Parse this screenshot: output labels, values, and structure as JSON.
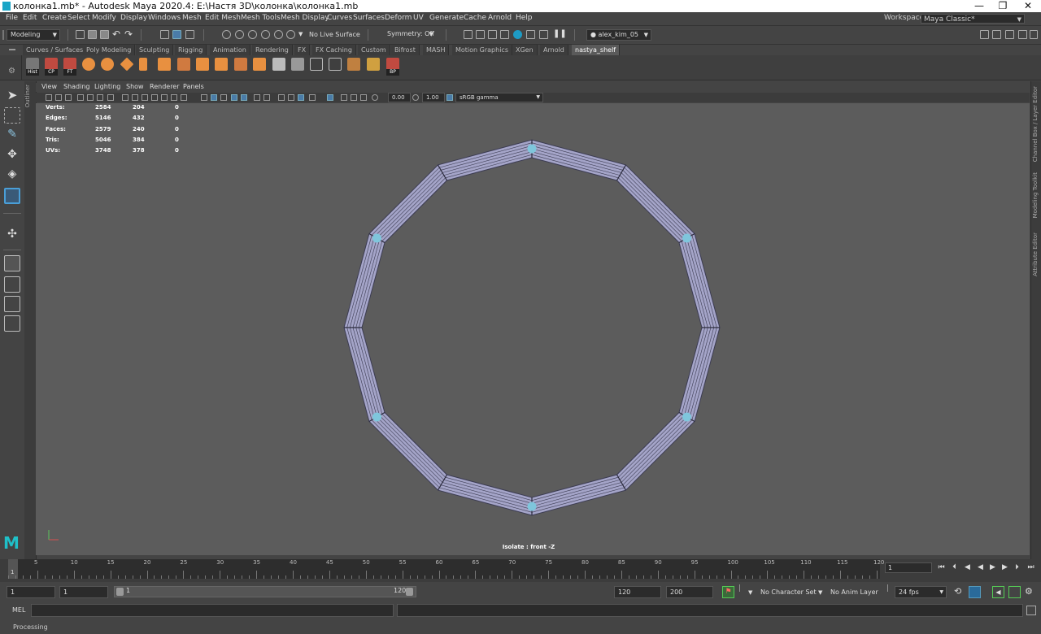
{
  "window": {
    "title": "колонка1.mb* - Autodesk Maya 2020.4: E:\\Настя 3D\\колонка\\колонка1.mb",
    "controls": [
      "—",
      "❐",
      "✕"
    ]
  },
  "menubar": {
    "items": [
      "File",
      "Edit",
      "Create",
      "Select",
      "Modify",
      "Display",
      "Windows",
      "Mesh",
      "Edit Mesh",
      "Mesh Tools",
      "Mesh Display",
      "Curves",
      "Surfaces",
      "Deform",
      "UV",
      "Generate",
      "Cache",
      "Arnold",
      "Help"
    ],
    "workspace_label": "Workspace :",
    "workspace_value": "Maya Classic*"
  },
  "statusline": {
    "mode": "Modeling",
    "live_surface": "No Live Surface",
    "symmetry": "Symmetry: Off",
    "user": "alex_kim_05"
  },
  "shelf": {
    "tabs": [
      "Curves / Surfaces",
      "Poly Modeling",
      "Sculpting",
      "Rigging",
      "Animation",
      "Rendering",
      "FX",
      "FX Caching",
      "Custom",
      "Bifrost",
      "MASH",
      "Motion Graphics",
      "XGen",
      "Arnold",
      "nastya_shelf"
    ],
    "active_tab": "nastya_shelf",
    "button_labels": [
      "Hist",
      "CP",
      "FT",
      "BP"
    ]
  },
  "panel": {
    "menus": [
      "View",
      "Shading",
      "Lighting",
      "Show",
      "Renderer",
      "Panels"
    ],
    "exposure": "0.00",
    "gamma": "1.00",
    "color_space": "sRGB gamma"
  },
  "outliner_label": "Outliner",
  "right_tabs": [
    "Channel Box / Layer Editor",
    "Modeling Toolkit",
    "Attribute Editor"
  ],
  "hud": {
    "rows": [
      {
        "label": "Verts:",
        "a": "2584",
        "b": "204",
        "c": "0"
      },
      {
        "label": "Edges:",
        "a": "5146",
        "b": "432",
        "c": "0"
      },
      {
        "label": "Faces:",
        "a": "2579",
        "b": "240",
        "c": "0"
      },
      {
        "label": "Tris:",
        "a": "5046",
        "b": "384",
        "c": "0"
      },
      {
        "label": "UVs:",
        "a": "3748",
        "b": "378",
        "c": "0"
      }
    ]
  },
  "viewport": {
    "isolate_label": "Isolate : front -Z",
    "mesh_color": "#a4a4c8",
    "vertex_color": "#7fc6dc"
  },
  "timeline": {
    "ticks": [
      "5",
      "10",
      "15",
      "20",
      "25",
      "30",
      "35",
      "40",
      "45",
      "50",
      "55",
      "60",
      "65",
      "70",
      "75",
      "80",
      "85",
      "90",
      "95",
      "100",
      "105",
      "110",
      "115",
      "120"
    ],
    "start_label": "1",
    "end_label": "120",
    "current_frame": "1"
  },
  "range": {
    "start_field": "1",
    "playback_start": "1",
    "slider_start": "1",
    "slider_end": "120",
    "playback_end": "120",
    "end_field": "200",
    "character_set": "No Character Set",
    "anim_layer": "No Anim Layer",
    "fps": "24 fps"
  },
  "commandline": {
    "label": "MEL"
  },
  "helpline": {
    "text": "Processing"
  }
}
